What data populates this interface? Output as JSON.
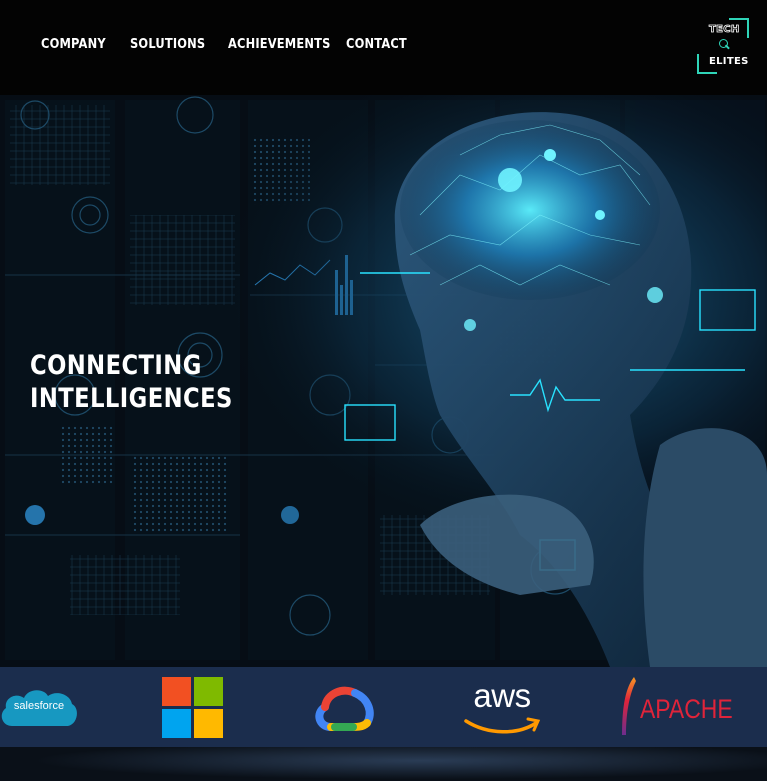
{
  "nav": {
    "items": [
      "COMPANY",
      "SOLUTIONS",
      "ACHIEVEMENTS",
      "CONTACT"
    ],
    "logo": {
      "line1": "TECH",
      "line2": "ELITES"
    }
  },
  "hero": {
    "headline_line1": "CONNECTING",
    "headline_line2": "INTELLIGENCES"
  },
  "partners": {
    "salesforce": "salesforce",
    "aws": "aws",
    "apache": "APACHE"
  },
  "colors": {
    "nav_bg": "#030303",
    "strip_bg": "#1b2d4d",
    "accent_cyan": "#2fd4b8",
    "apache_red": "#e0243a"
  },
  "icons": [
    "salesforce-logo",
    "microsoft-logo",
    "google-cloud-logo",
    "aws-logo",
    "apache-feather-logo",
    "tech-elites-logo"
  ]
}
